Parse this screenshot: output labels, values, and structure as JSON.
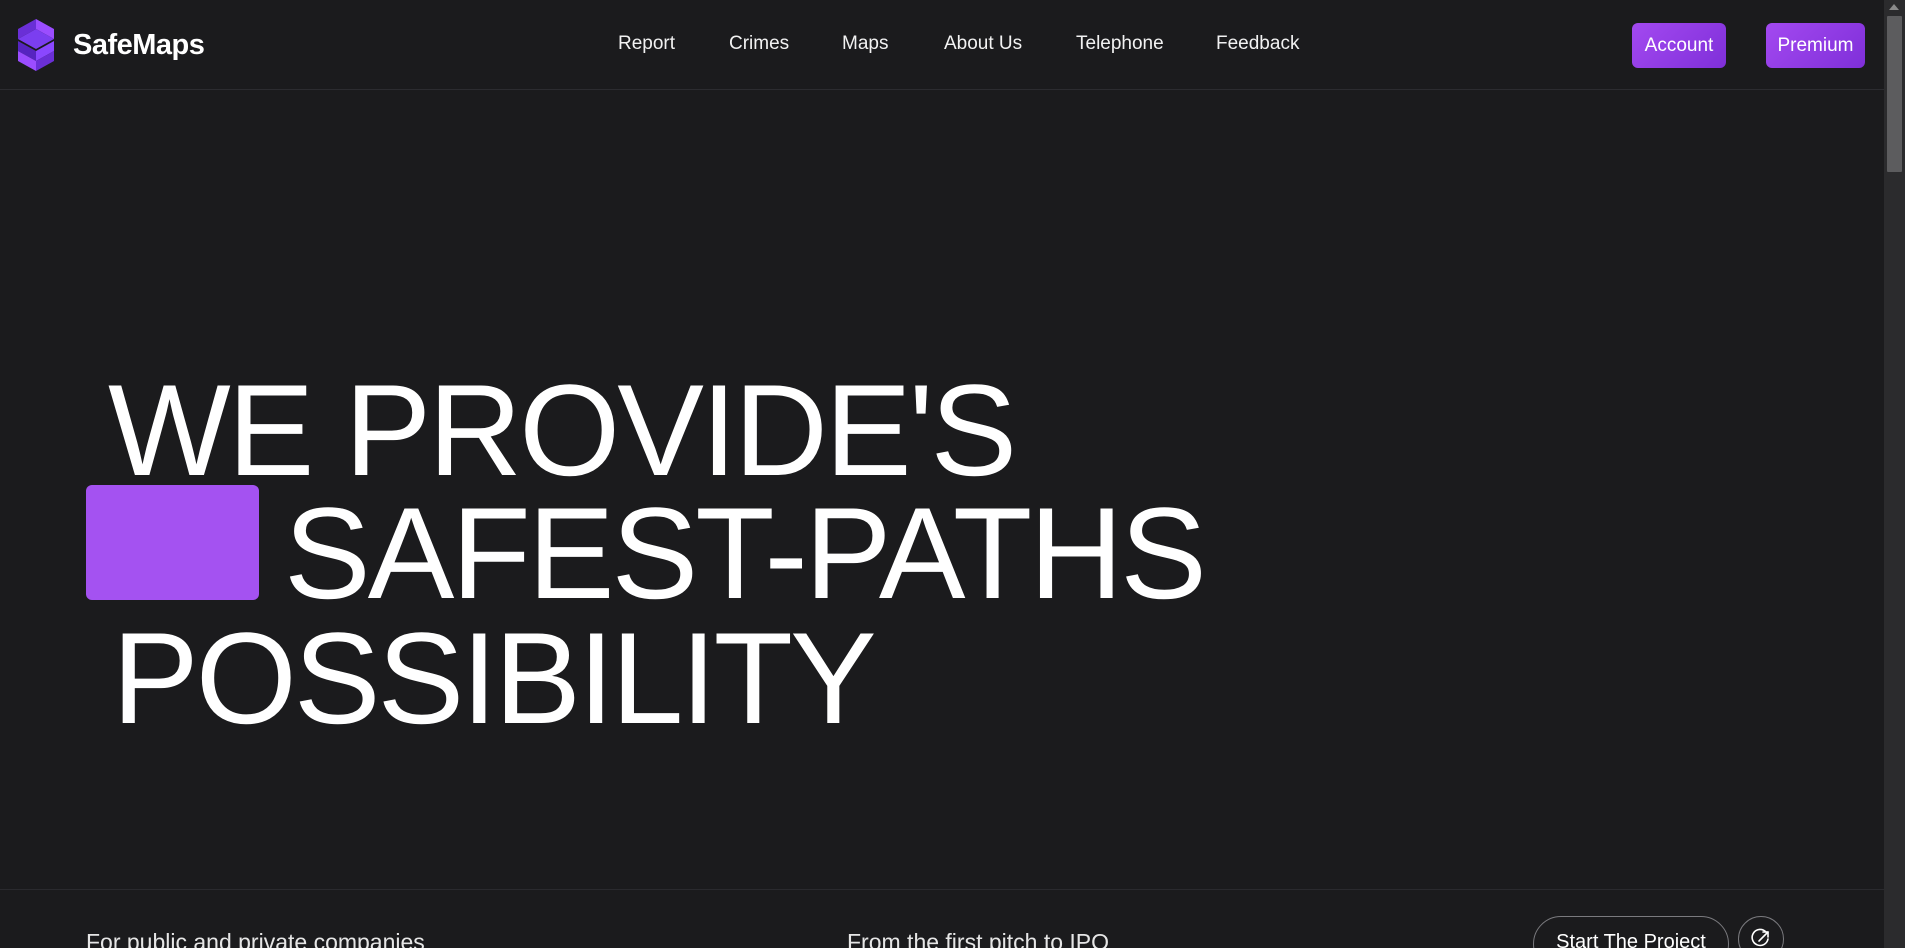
{
  "brand": {
    "name": "SafeMaps",
    "logo_icon": "stacked-s-logo-icon",
    "accent": "#a452f1"
  },
  "nav": {
    "items": [
      {
        "label": "Report"
      },
      {
        "label": "Crimes"
      },
      {
        "label": "Maps"
      },
      {
        "label": "About Us"
      },
      {
        "label": "Telephone"
      },
      {
        "label": "Feedback"
      }
    ]
  },
  "header_actions": {
    "account_label": "Account",
    "premium_label": "Premium"
  },
  "hero": {
    "line1": "WE PROVIDE'S",
    "line2": "SAFEST-PATHS",
    "line3": "POSSIBILITY"
  },
  "footer_strip": {
    "left_text": "For public and private companies",
    "middle_text": "From the first pitch to IPO",
    "start_label": "Start The Project",
    "arrow_icon": "arrow-up-right-icon"
  },
  "colors": {
    "background": "#1b1b1d",
    "button_gradient_start": "#a349f0",
    "button_gradient_end": "#7f2fd9"
  }
}
